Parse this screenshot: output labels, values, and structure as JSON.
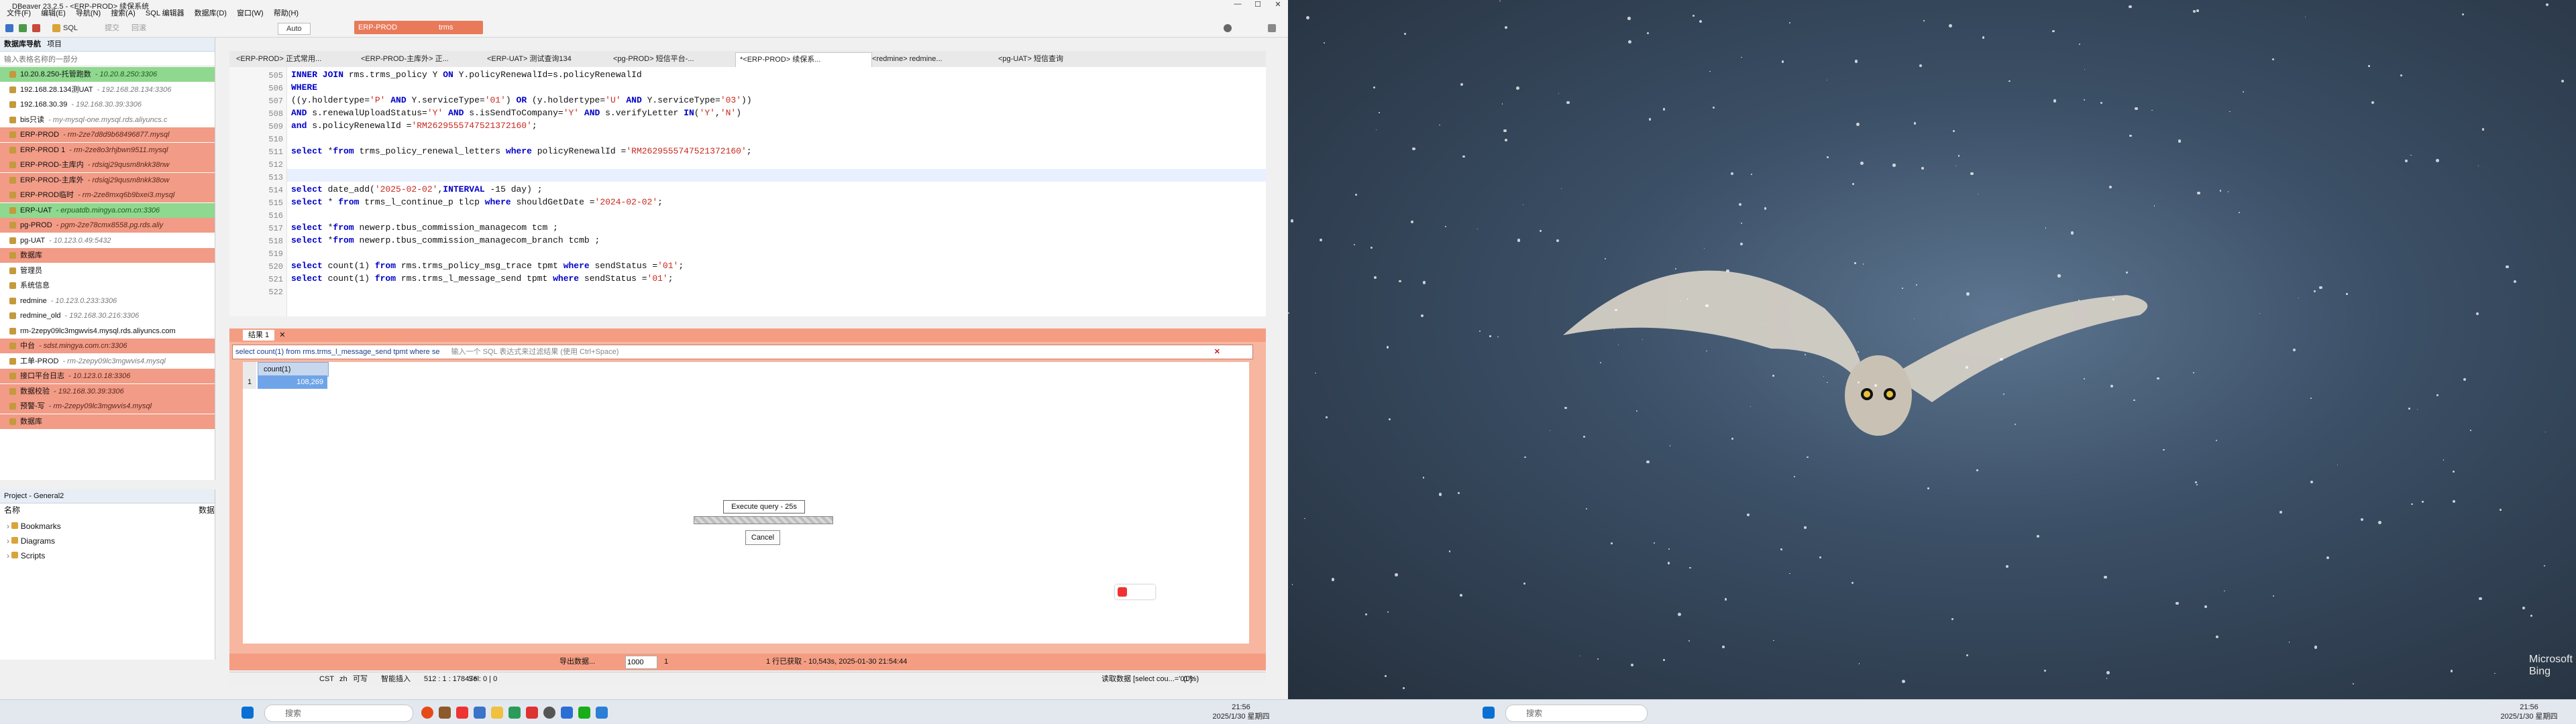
{
  "app": {
    "title": "DBeaver 23.2.5 - <ERP-PROD> 续保系统",
    "menu": [
      "文件(F)",
      "编辑(E)",
      "导航(N)",
      "搜索(A)",
      "SQL 编辑器",
      "数据库(D)",
      "窗口(W)",
      "帮助(H)"
    ],
    "toolbar": {
      "sql_label": "SQL",
      "commit_label": "提交",
      "rollback_label": "回滚",
      "auto_label": "Auto",
      "connection": "ERP-PROD",
      "schema": "trms"
    }
  },
  "navigator": {
    "tab1": "数据库导航",
    "tab2": "项目",
    "filter_placeholder": "输入表格名称的一部分",
    "items": [
      {
        "name": "10.20.8.250-托管跑数",
        "addr": "- 10.20.8.250:3306",
        "style": "uat"
      },
      {
        "name": "192.168.28.134测UAT",
        "addr": "- 192.168.28.134:3306",
        "style": ""
      },
      {
        "name": "192.168.30.39",
        "addr": "- 192.168.30.39:3306",
        "style": ""
      },
      {
        "name": "bis只读",
        "addr": "- my-mysql-one.mysql.rds.aliyuncs.c",
        "style": ""
      },
      {
        "name": "ERP-PROD",
        "addr": "- rm-2ze7d8d9b68496877.mysql",
        "style": "prod"
      },
      {
        "name": "ERP-PROD 1",
        "addr": "- rm-2ze8o3rhjbwn9511.mysql",
        "style": "prod"
      },
      {
        "name": "ERP-PROD-主库内",
        "addr": "- rdsiqj29qusm8nkk38nw",
        "style": "prod"
      },
      {
        "name": "ERP-PROD-主库外",
        "addr": "- rdsiqj29qusm8nkk38ow",
        "style": "prod"
      },
      {
        "name": "ERP-PROD临时",
        "addr": "- rm-2ze8mxq6b9bxei3.mysql",
        "style": "prod"
      },
      {
        "name": "ERP-UAT",
        "addr": "- erpuatdb.mingya.com.cn:3306",
        "style": "uat"
      },
      {
        "name": "pg-PROD",
        "addr": "- pgm-2ze78cmx8558.pg.rds.aliy",
        "style": "prod"
      },
      {
        "name": "pg-UAT",
        "addr": "- 10.123.0.49:5432",
        "style": ""
      },
      {
        "name": "数据库",
        "addr": "",
        "style": "sub"
      },
      {
        "name": "管理员",
        "addr": "",
        "style": ""
      },
      {
        "name": "系统信息",
        "addr": "",
        "style": ""
      },
      {
        "name": "redmine",
        "addr": "- 10.123.0.233:3306",
        "style": ""
      },
      {
        "name": "redmine_old",
        "addr": "- 192.168.30.216:3306",
        "style": ""
      },
      {
        "name": "rm-2zepy09lc3mgwvis4.mysql.rds.aliyuncs.com",
        "addr": "",
        "style": ""
      },
      {
        "name": "中台",
        "addr": "- sdst.mingya.com.cn:3306",
        "style": "prod"
      },
      {
        "name": "工单-PROD",
        "addr": "- rm-2zepy09lc3mgwvis4.mysql",
        "style": ""
      },
      {
        "name": "接口平台日志",
        "addr": "- 10.123.0.18:3306",
        "style": "prod"
      },
      {
        "name": "数据校验",
        "addr": "- 192.168.30.39:3306",
        "style": "prod"
      },
      {
        "name": "预警-写",
        "addr": "- rm-2zepy09lc3mgwvis4.mysql",
        "style": "prod"
      },
      {
        "name": "数据库",
        "addr": "",
        "style": "prod"
      }
    ]
  },
  "project": {
    "title": "Project - General2",
    "col_name": "名称",
    "col_data": "数据",
    "items": [
      "Bookmarks",
      "Diagrams",
      "Scripts"
    ]
  },
  "editor": {
    "tabs": [
      "<ERP-PROD> 正式常用...",
      "<ERP-PROD-主库外> 正...",
      "<ERP-UAT> 测试查询134",
      "<pg-PROD> 短信平台-...",
      "*<ERP-PROD> 续保系...",
      "<redmine> redmine...",
      "<pg-UAT> 短信查询"
    ],
    "line_numbers": [
      "505",
      "506",
      "507",
      "508",
      "509",
      "510",
      "511",
      "512",
      "513",
      "514",
      "515",
      "516",
      "517",
      "518",
      "519",
      "520",
      "521",
      "522"
    ]
  },
  "results": {
    "tab_label": "结果 1",
    "filter_text": "select count(1) from rms.trms_l_message_send tpmt where se",
    "filter_hint": "输入一个 SQL 表达式来过滤结果 (使用 Ctrl+Space)",
    "column": "count(1)",
    "row_num": "1",
    "value": "108,269",
    "progress_label": "Execute query - 25s",
    "cancel_label": "Cancel",
    "export_label": "导出数据...",
    "fetch_size": "1000",
    "page": "1",
    "status": "1 行已获取 - 10,543s, 2025-01-30 21:54:44"
  },
  "statusbar": {
    "cst": "CST",
    "zh": "zh",
    "writable": "可写",
    "insert": "智能插入",
    "pos": "512 : 1 : 178476",
    "sel": "Sel: 0 | 0",
    "fetch": "读取数据 [select cou...='01']:",
    "pct": "(0%)"
  },
  "taskbar": {
    "search": "搜索",
    "time": "21:56",
    "date": "2025/1/30 星期四"
  },
  "wallpaper": {
    "brand": "Microsoft Bing"
  },
  "colors": {
    "prod": "#f29b86",
    "uat": "#8fd88f",
    "result_bg": "#f7b6a0",
    "accent": "#0000c8"
  }
}
